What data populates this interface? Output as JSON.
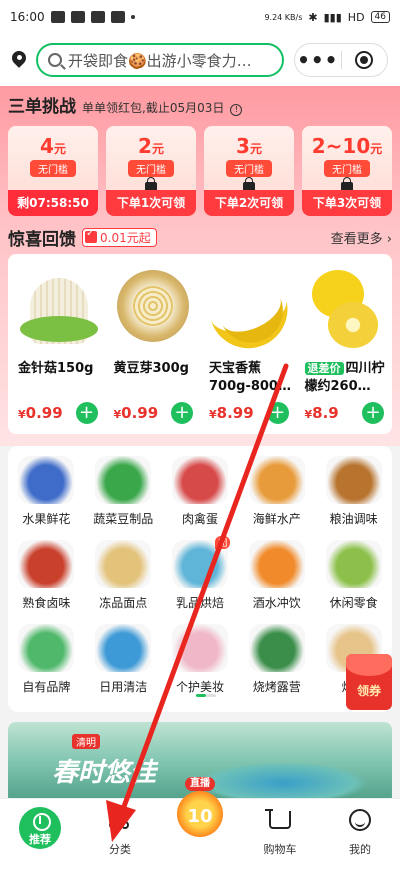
{
  "status": {
    "time": "16:00",
    "speed": "9.24 KB/s",
    "network": "HD",
    "battery": "46"
  },
  "search": {
    "placeholder": "开袋即食🍪出游小零食力…",
    "more": "•••"
  },
  "challenge": {
    "title": "三单挑战",
    "subtitle": "单单领红包,截止05月03日",
    "coupons": [
      {
        "amount": "4",
        "unit": "元",
        "tag": "无门槛",
        "footer": "剩07:58:50"
      },
      {
        "amount": "2",
        "unit": "元",
        "tag": "无门槛",
        "footer": "下单1次可领"
      },
      {
        "amount": "3",
        "unit": "元",
        "tag": "无门槛",
        "footer": "下单2次可领"
      },
      {
        "amount": "2~10",
        "unit": "元",
        "tag": "无门槛",
        "footer": "下单3次可领"
      }
    ]
  },
  "surprise": {
    "title": "惊喜回馈",
    "badge": "0.01元起",
    "more": "查看更多",
    "products": [
      {
        "name": "金针菇150g",
        "price": "0.99",
        "currency": "¥"
      },
      {
        "name": "黄豆芽300g",
        "price": "0.99",
        "currency": "¥"
      },
      {
        "name": "天宝香蕉700g-800…",
        "price": "8.99",
        "currency": "¥"
      },
      {
        "tag": "退差价",
        "name": "四川柠檬约260…",
        "price": "8.9",
        "currency": "¥"
      }
    ]
  },
  "categories": [
    {
      "label": "水果鲜花",
      "icon": "blueberry-icon",
      "color": "#3f6cc9"
    },
    {
      "label": "蔬菜豆制品",
      "icon": "vegetable-icon",
      "color": "#3aa74a"
    },
    {
      "label": "肉禽蛋",
      "icon": "meat-icon",
      "color": "#d74a4a"
    },
    {
      "label": "海鲜水产",
      "icon": "fish-icon",
      "color": "#e89b3a"
    },
    {
      "label": "粮油调味",
      "icon": "oil-icon",
      "color": "#b8742f"
    },
    {
      "label": "熟食卤味",
      "icon": "crayfish-icon",
      "color": "#c9402c"
    },
    {
      "label": "冻品面点",
      "icon": "dumpling-icon",
      "color": "#e3c27a"
    },
    {
      "label": "乳品烘焙",
      "icon": "milk-icon",
      "color": "#5fb5d8",
      "hot": "团"
    },
    {
      "label": "酒水冲饮",
      "icon": "drink-icon",
      "color": "#f08a2a"
    },
    {
      "label": "休闲零食",
      "icon": "snack-icon",
      "color": "#8cc04a"
    },
    {
      "label": "自有品牌",
      "icon": "brand-icon",
      "color": "#4fb86a"
    },
    {
      "label": "日用清洁",
      "icon": "cleaning-icon",
      "color": "#3e9ad6"
    },
    {
      "label": "个护美妆",
      "icon": "cosmetic-icon",
      "color": "#f0b7c8"
    },
    {
      "label": "烧烤露营",
      "icon": "tent-icon",
      "color": "#3a8e4a"
    },
    {
      "label": "烘焙",
      "icon": "cake-icon",
      "color": "#e7c48a"
    }
  ],
  "float_coupon": "领券",
  "banner": {
    "tag": "清明",
    "text": "春时悠佳"
  },
  "bottom_nav": [
    {
      "label": "推荐",
      "icon": "recommend-icon"
    },
    {
      "label": "分类",
      "icon": "category-icon"
    },
    {
      "label": "直播",
      "icon": "live-icon",
      "number": "10"
    },
    {
      "label": "购物车",
      "icon": "cart-icon"
    },
    {
      "label": "我的",
      "icon": "profile-icon"
    }
  ]
}
